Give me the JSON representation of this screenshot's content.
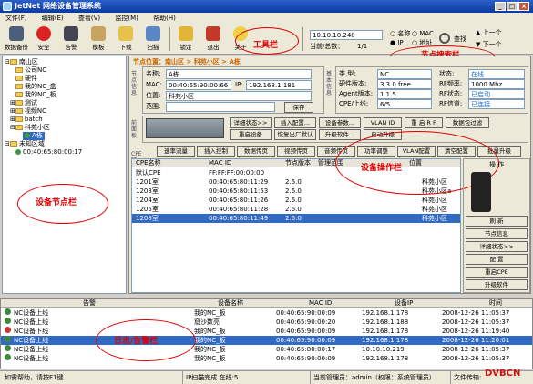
{
  "window": {
    "title": "JetNet 网络设备管理系统",
    "btn_min": "_",
    "btn_max": "□",
    "btn_close": "×"
  },
  "menu": [
    "文件(F)",
    "编辑(E)",
    "查看(V)",
    "监控(M)",
    "帮助(H)"
  ],
  "toolbar": [
    "数据备份",
    "安全",
    "告警",
    "模板",
    "下载",
    "扫描",
    "锁定",
    "退出",
    "关于"
  ],
  "search": {
    "ip_value": "10.10.10.240",
    "manager_label": "当前/总数：",
    "count": "1/1",
    "option_name": "名称",
    "option_mac": "MAC",
    "option_ip": "IP",
    "option_addr": "地址",
    "search_label": "查找",
    "prev_label": "上一个",
    "next_label": "下一个"
  },
  "annotations": {
    "toolbar": "工具栏",
    "search": "节点搜索栏",
    "tree": "设备节点栏",
    "ops": "设备操作栏",
    "log": "日志/告警栏"
  },
  "tree": [
    "南山区",
    "公司NC",
    "硬件",
    "我的NC_盒",
    "我的NC_板",
    "测试",
    "视频NC",
    "batch",
    "科苑小区",
    "A栋",
    "未知区域",
    "00:40:65:80:00:17"
  ],
  "detail": {
    "breadcrumb": "节点位置：南山区 > 科苑小区 > A栋",
    "side_info": "节点信息",
    "side_base": "基本信息",
    "side_panel": "前面板",
    "side_cpe": "CPE管理",
    "name_label": "名称:",
    "name_value": "A栋",
    "mac_label": "MAC:",
    "mac_value": "00:40:65:90:00:66",
    "ip_label": "IP:",
    "ip_value": "192.168.1.181",
    "pos_label": "位置:",
    "pos_value": "科苑小区",
    "range_label": "范围:",
    "save_btn": "保存",
    "type_label": "类 型:",
    "type_value": "NC",
    "hw_label": "硬件版本:",
    "hw_value": "3.3.0 free",
    "agent_label": "Agent版本:",
    "agent_value": "1.1.5",
    "cpe_label": "CPE/上线:",
    "cpe_value": "6/5",
    "state_label": "状态:",
    "state_value": "在线",
    "rf_freq_label": "RF频率:",
    "rf_freq_value": "1000 Mhz",
    "rf_state_label": "RF状态:",
    "rf_state_value": "已启动",
    "rf_ch_label": "RF信道:",
    "rf_ch_value": "已连接"
  },
  "panel_buttons": [
    "详细状态>>",
    "插入配置...",
    "设备参数...",
    "VLAN ID",
    "重 启 R F",
    "数据包过滤",
    "重启设备",
    "恢复出厂默认",
    "升级软件...",
    "自动升级"
  ],
  "cpe_tabs": [
    "速率流量",
    "插入控制",
    "数据传页",
    "视频传页",
    "音频传页",
    "功率调整",
    "VLAN配置",
    "清空配置",
    "批量升级"
  ],
  "cpe_columns": [
    "CPE名称",
    "MAC ID",
    "节点版本",
    "管理范围",
    "位置",
    "操 作"
  ],
  "cpe_rows": [
    {
      "name": "默认CPE",
      "mac": "FF:FF:FF:00:00:00",
      "ver": "",
      "loc": ""
    },
    {
      "name": "1201室",
      "mac": "00:40:65:80:11:29",
      "ver": "2.6.0",
      "loc": "科苑小区"
    },
    {
      "name": "1203室",
      "mac": "00:40:65:80:11:53",
      "ver": "2.6.0",
      "loc": "科苑小区a"
    },
    {
      "name": "1204室",
      "mac": "00:40:65:80:11:26",
      "ver": "2.6.0",
      "loc": "科苑小区"
    },
    {
      "name": "1205室",
      "mac": "00:40:65:80:11:28",
      "ver": "2.6.0",
      "loc": "科苑小区"
    },
    {
      "name": "1208室",
      "mac": "00:40:65:80:11:49",
      "ver": "2.6.0",
      "loc": "科苑小区"
    }
  ],
  "cpe_ops": [
    "刷 新",
    "节点信息",
    "详细状态>>",
    "配 置",
    "重启CPE",
    "升级软件",
    "设备参数"
  ],
  "log_columns": [
    "告警",
    "设备名称",
    "MAC ID",
    "设备IP",
    "时间"
  ],
  "log_rows": [
    {
      "msg": "NC设备上线",
      "name": "我的NC_板",
      "mac": "00:40:65:90:00:09",
      "ip": "192.168.1.178",
      "time": "2008-12-26 11:05:37"
    },
    {
      "msg": "NC设备上线",
      "name": "窟沙数亮",
      "mac": "00:40:65:90:00:20",
      "ip": "192.168.1.188",
      "time": "2008-12-26 11:05:37"
    },
    {
      "msg": "NC设备下线",
      "name": "我的NC_板",
      "mac": "00:40:65:90:00:09",
      "ip": "192.168.1.178",
      "time": "2008-12-26 11:19:40"
    },
    {
      "msg": "NC设备上线",
      "name": "我的NC_板",
      "mac": "00:40:65:90:00:09",
      "ip": "192.168.1.178",
      "time": "2008-12-26 11:20:01"
    },
    {
      "msg": "NC设备上线",
      "name": "我的NC_板",
      "mac": "00:40:65:80:00:17",
      "ip": "10.10.10.219",
      "time": "2008-12-26 11:05:37"
    },
    {
      "msg": "NC设备上线",
      "name": "我的NC_板",
      "mac": "00:40:65:90:00:09",
      "ip": "192.168.1.178",
      "time": "2008-12-26 11:05:37"
    }
  ],
  "status": {
    "ready": "如需帮助，请按F1键",
    "scan": "IP扫描完成 在线:5",
    "admin": "当前管理员：admin（权限：系统管理员）",
    "transfer": "文件传输:",
    "watermark": "DVBCN"
  },
  "colors": {
    "title": "#0a3aa0",
    "annotation": "#e00000",
    "selected": "#316ac5",
    "online": "#1a8a1a"
  }
}
